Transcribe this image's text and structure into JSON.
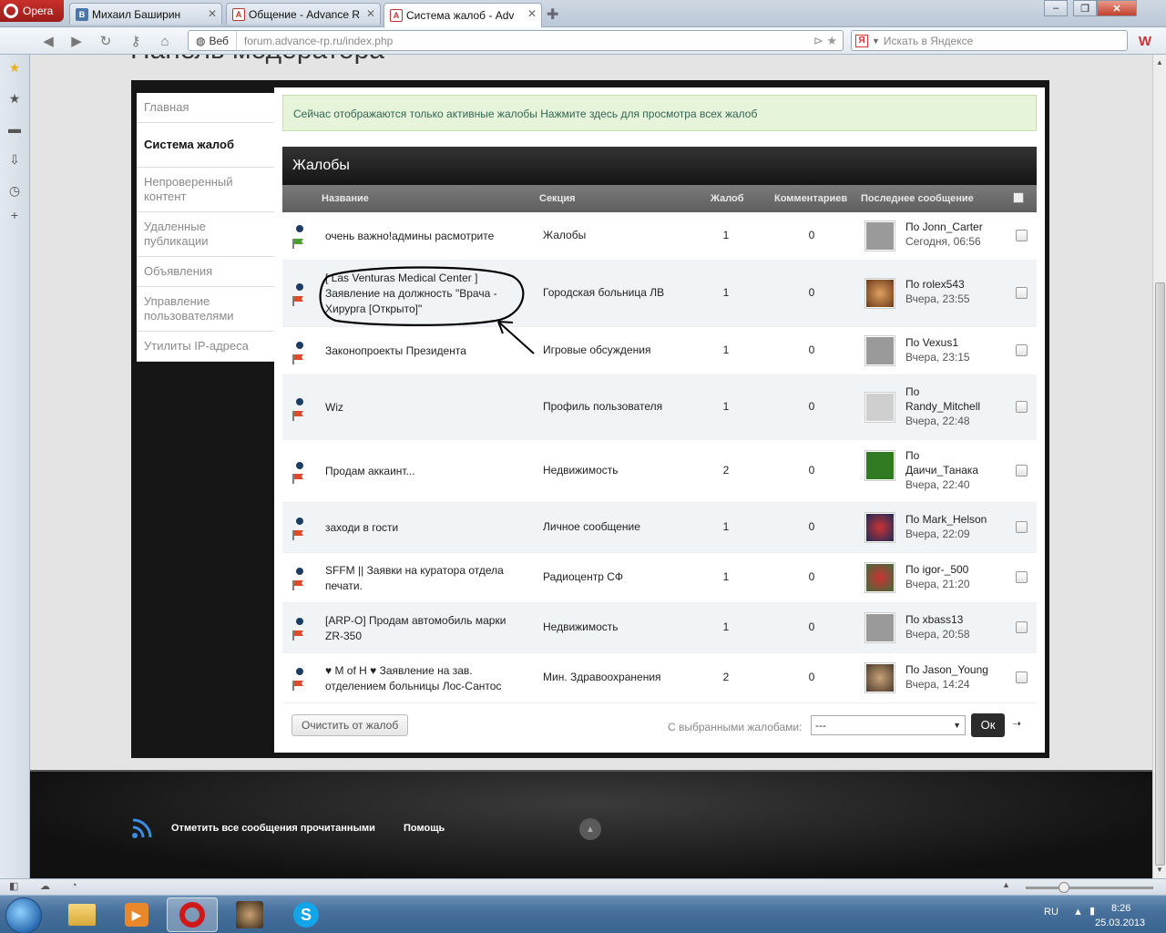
{
  "browser": {
    "menu_label": "Opera",
    "tabs": [
      {
        "label": "Михаил Баширин",
        "icon": "vk-icon"
      },
      {
        "label": "Общение - Advance R",
        "icon": "advance-icon"
      },
      {
        "label": "Система жалоб - Adv",
        "icon": "advance-icon",
        "active": true
      }
    ],
    "address": {
      "scheme_label": "Веб",
      "url": "forum.advance-rp.ru/index.php",
      "host": "forum.advance-rp.ru"
    },
    "search_placeholder": "Искать в Яндексе",
    "search_badge": "Я",
    "window_controls": {
      "minimize": "–",
      "restore": "❐",
      "close": "✕"
    }
  },
  "page": {
    "title": "Панель модератора",
    "sidebar": [
      {
        "label": "Главная",
        "active": false
      },
      {
        "label": "Система жалоб",
        "active": true
      },
      {
        "label": "Непроверенный контент",
        "active": false
      },
      {
        "label": "Удаленные публикации",
        "active": false
      },
      {
        "label": "Объявления",
        "active": false
      },
      {
        "label": "Управление пользователями",
        "active": false
      },
      {
        "label": "Утилиты IP-адреса",
        "active": false
      }
    ],
    "notice": "Сейчас отображаются только активные жалобы Нажмите здесь для просмотра всех жалоб",
    "table_title": "Жалобы",
    "columns": {
      "name": "Название",
      "section": "Секция",
      "reports": "Жалоб",
      "comments": "Комментариев",
      "last": "Последнее сообщение"
    },
    "rows": [
      {
        "title": "очень важно!админы расмотрите",
        "section": "Жалобы",
        "reports": "1",
        "comments": "0",
        "by": "По",
        "user": "Jonn_Carter",
        "when": "Сегодня, 06:56",
        "avatar": "#9a9a9a"
      },
      {
        "title": "[ Las Venturas Medical Center ] Заявление на должность \"Врача - Хирурга [Открыто]\"",
        "section": "Городская больница ЛВ",
        "reports": "1",
        "comments": "0",
        "by": "По",
        "user": "rolex543",
        "when": "Вчера, 23:55",
        "avatar": "#a86a3a"
      },
      {
        "title": "Законопроекты Президента",
        "section": "Игровые обсуждения",
        "reports": "1",
        "comments": "0",
        "by": "По",
        "user": "Vexus1",
        "when": "Вчера, 23:15",
        "avatar": "#9a9a9a"
      },
      {
        "title": "Wiz",
        "section": "Профиль пользователя",
        "reports": "1",
        "comments": "0",
        "by": "По",
        "user": "Randy_Mitchell",
        "when": "Вчера, 22:48",
        "avatar": "#cfcfcf"
      },
      {
        "title": "Продам аккаинт...",
        "section": "Недвижимость",
        "reports": "2",
        "comments": "0",
        "by": "По",
        "user": "Даичи_Танака",
        "when": "Вчера, 22:40",
        "avatar": "#2f7a22"
      },
      {
        "title": "заходи в гости",
        "section": "Личное сообщение",
        "reports": "1",
        "comments": "0",
        "by": "По",
        "user": "Mark_Helson",
        "when": "Вчера, 22:09",
        "avatar": "#273a6a"
      },
      {
        "title": "SFFM || Заявки на куратора отдела печати.",
        "section": "Радиоцентр СФ",
        "reports": "1",
        "comments": "0",
        "by": "По",
        "user": "igor-_500",
        "when": "Вчера, 21:20",
        "avatar": "#3f6b3a"
      },
      {
        "title": "[ARP-O] Продам автомобиль марки ZR-350",
        "section": "Недвижимость",
        "reports": "1",
        "comments": "0",
        "by": "По",
        "user": "xbass13",
        "when": "Вчера, 20:58",
        "avatar": "#9a9a9a"
      },
      {
        "title": "♥ M of H ♥ Заявление на зав. отделением больницы Лос-Сантос",
        "section": "Мин. Здравоохранения",
        "reports": "2",
        "comments": "0",
        "by": "По",
        "user": "Jason_Young",
        "when": "Вчера, 14:24",
        "avatar": "#6a5a4a"
      }
    ],
    "clear_button": "Очистить от жалоб",
    "bulk_label": "С выбранными жалобами:",
    "bulk_value": "---",
    "ok_button": "Ок",
    "footer": {
      "mark_read": "Отметить все сообщения прочитанными",
      "help": "Помощь"
    }
  },
  "taskbar": {
    "lang": "RU",
    "time": "8:26",
    "date": "25.03.2013"
  }
}
